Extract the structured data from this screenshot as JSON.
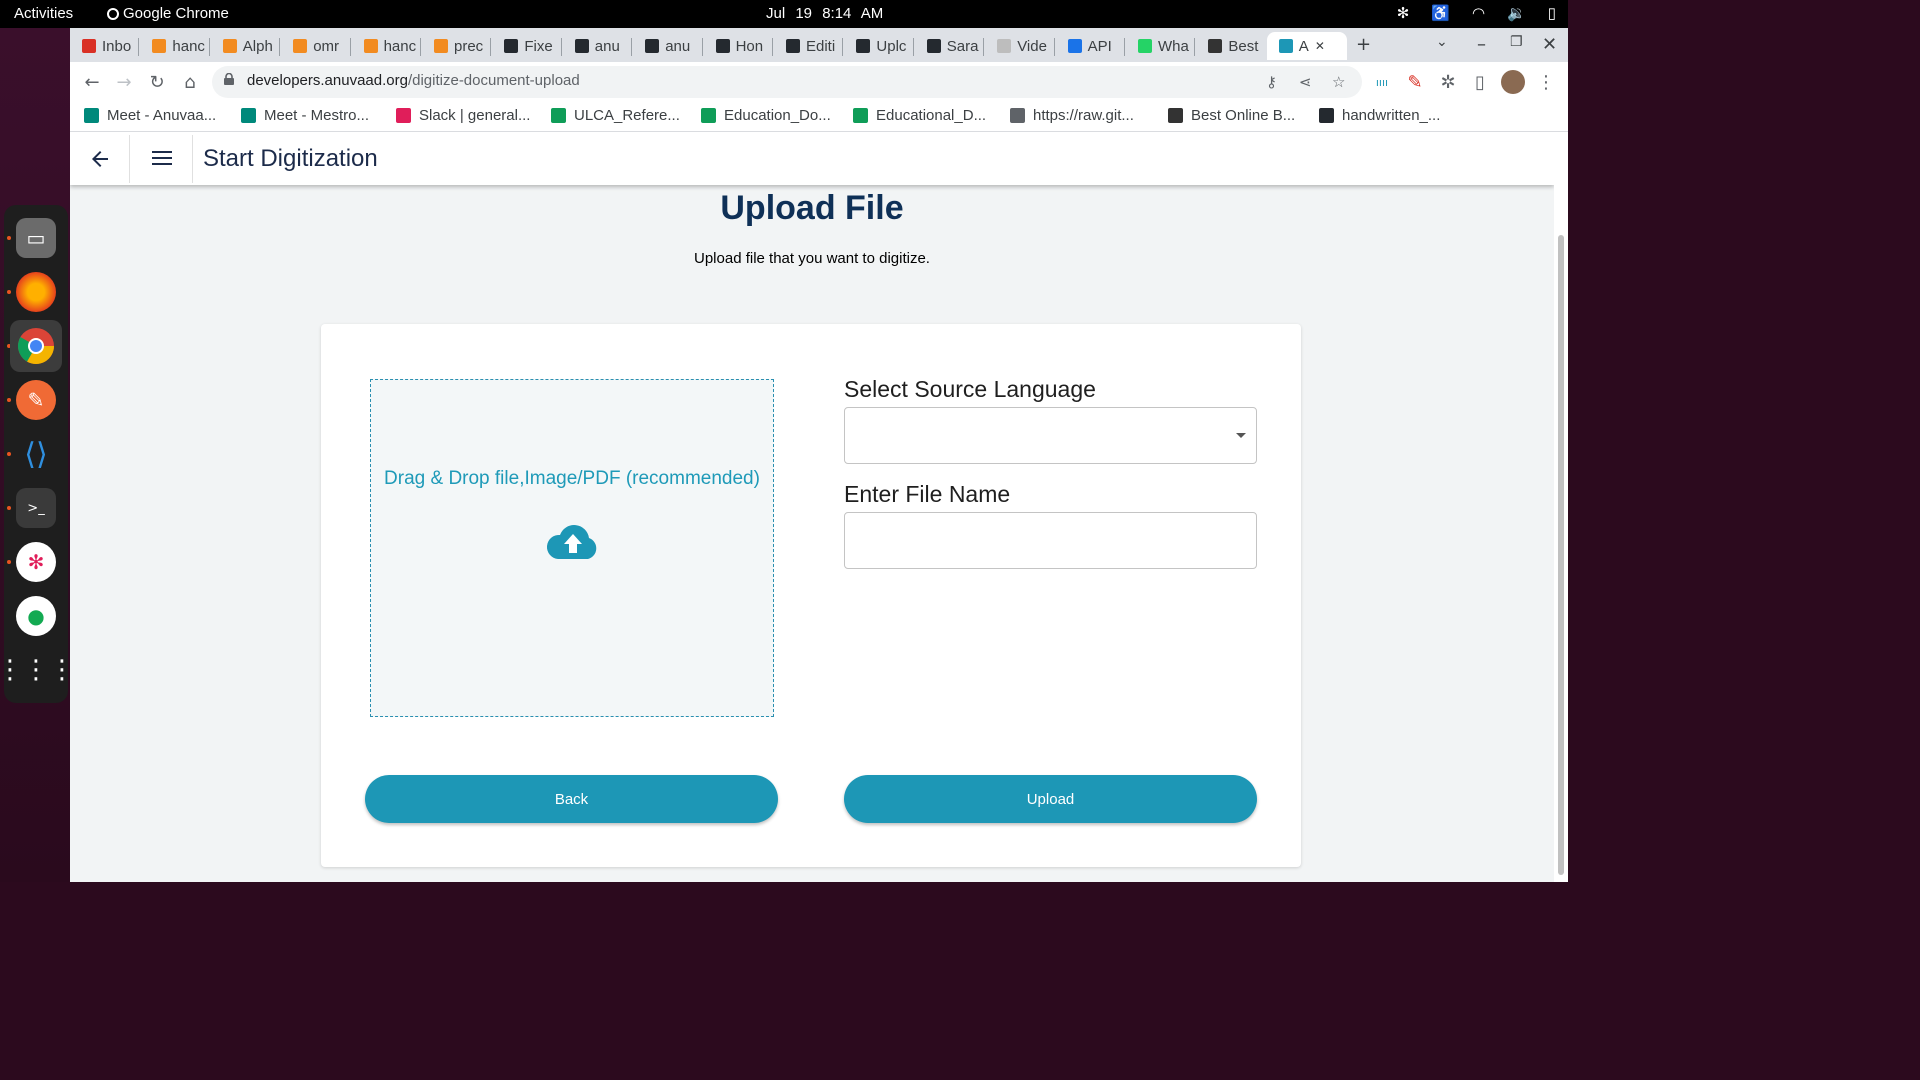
{
  "system": {
    "activities": "Activities",
    "app_name": "Google Chrome",
    "clock": "Jul 19  8:14 AM"
  },
  "browser": {
    "tabs": [
      {
        "label": "Inbo",
        "icon": "gmail-icon",
        "color": "#d93025"
      },
      {
        "label": "hanc",
        "icon": "loader-icon",
        "color": "#f28b20"
      },
      {
        "label": "Alph",
        "icon": "book-icon",
        "color": "#f28b20"
      },
      {
        "label": "omr",
        "icon": "book-icon",
        "color": "#f28b20"
      },
      {
        "label": "hanc",
        "icon": "book-icon",
        "color": "#f28b20"
      },
      {
        "label": "prec",
        "icon": "book-icon",
        "color": "#f28b20"
      },
      {
        "label": "Fixe",
        "icon": "github-icon",
        "color": "#24292f"
      },
      {
        "label": "anu",
        "icon": "github-icon",
        "color": "#24292f"
      },
      {
        "label": "anu",
        "icon": "github-icon",
        "color": "#24292f"
      },
      {
        "label": "Hon",
        "icon": "github-icon",
        "color": "#24292f"
      },
      {
        "label": "Editi",
        "icon": "github-icon",
        "color": "#24292f"
      },
      {
        "label": "Uplc",
        "icon": "github-icon",
        "color": "#24292f"
      },
      {
        "label": "Sara",
        "icon": "github-icon",
        "color": "#24292f"
      },
      {
        "label": "Vide",
        "icon": "doc-icon",
        "color": "#bdbdbd"
      },
      {
        "label": "API",
        "icon": "globe-icon",
        "color": "#1a73e8"
      },
      {
        "label": "Wha",
        "icon": "whatsapp-icon",
        "color": "#25d366"
      },
      {
        "label": "Best",
        "icon": "cb-icon",
        "color": "#333333"
      },
      {
        "label": "A",
        "icon": "anuvaad-icon",
        "color": "#1d97b6"
      }
    ],
    "url_host": "developers.anuvaad.org",
    "url_path": "/digitize-document-upload",
    "bookmarks": [
      {
        "label": "Meet - Anuvaa...",
        "icon": "meet-icon",
        "color": "#00897b"
      },
      {
        "label": "Meet - Mestro...",
        "icon": "meet-icon",
        "color": "#00897b"
      },
      {
        "label": "Slack | general...",
        "icon": "slack-icon",
        "color": "#e01e5a"
      },
      {
        "label": "ULCA_Refere...",
        "icon": "sheets-icon",
        "color": "#0f9d58"
      },
      {
        "label": "Education_Do...",
        "icon": "sheets-icon",
        "color": "#0f9d58"
      },
      {
        "label": "Educational_D...",
        "icon": "sheets-icon",
        "color": "#0f9d58"
      },
      {
        "label": "https://raw.git...",
        "icon": "globe-icon",
        "color": "#5f6368"
      },
      {
        "label": "Best Online B...",
        "icon": "cb-icon",
        "color": "#333333"
      },
      {
        "label": "handwritten_...",
        "icon": "github-icon",
        "color": "#24292f"
      }
    ]
  },
  "app": {
    "title": "Start Digitization",
    "heading": "Upload File",
    "subheading": "Upload file that you want to digitize.",
    "dropzone_text": "Drag & Drop file,Image/PDF (recommended)",
    "source_language_label": "Select Source Language",
    "source_language_value": "",
    "file_name_label": "Enter File Name",
    "file_name_value": "",
    "back_label": "Back",
    "upload_label": "Upload",
    "accent_color": "#1d97b6"
  }
}
